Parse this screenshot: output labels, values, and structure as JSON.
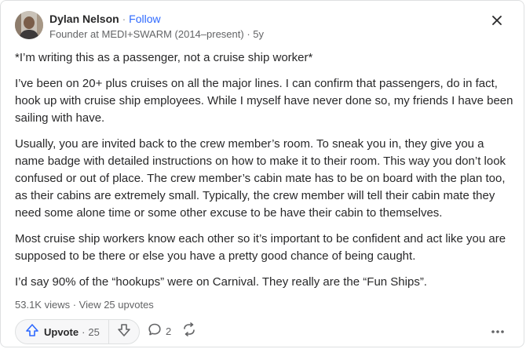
{
  "author": {
    "name": "Dylan Nelson",
    "separator": "·",
    "follow_label": "Follow",
    "credential": "Founder at MEDI+SWARM (2014–present) · 5y"
  },
  "post": {
    "paragraphs": [
      "*I’m writing this as a passenger, not a cruise ship worker*",
      "I’ve been on 20+ plus cruises on all the major lines. I can confirm that passengers, do in fact, hook up with cruise ship employees. While I myself have never done so, my friends I have been sailing with have.",
      "Usually, you are invited back to the crew member’s room. To sneak you in, they give you a name badge with detailed instructions on how to make it to their room. This way you don’t look confused or out of place. The crew member’s cabin mate has to be on board with the plan too, as their cabins are extremely small. Typically, the crew member will tell their cabin mate they need some alone time or some other excuse to be have their cabin to themselves.",
      "Most cruise ship workers know each other so it’s important to be confident and act like you are supposed to be there or else you have a pretty good chance of being caught.",
      "I’d say 90% of the “hookups” were on Carnival. They really are the “Fun Ships”."
    ]
  },
  "stats": {
    "text": "53.1K views · View 25 upvotes"
  },
  "actions": {
    "upvote_label": "Upvote",
    "dot": "·",
    "upvote_count": "25",
    "comment_count": "2"
  },
  "icons": {
    "close": "close-icon",
    "upvote": "arrow-up-icon",
    "downvote": "arrow-down-icon",
    "comment": "comment-bubble-icon",
    "share": "reshare-icon",
    "more": "more-dots-icon"
  },
  "colors": {
    "accent": "#2e69ff",
    "text": "#282829",
    "muted": "#636466",
    "border": "#dee0e1"
  }
}
